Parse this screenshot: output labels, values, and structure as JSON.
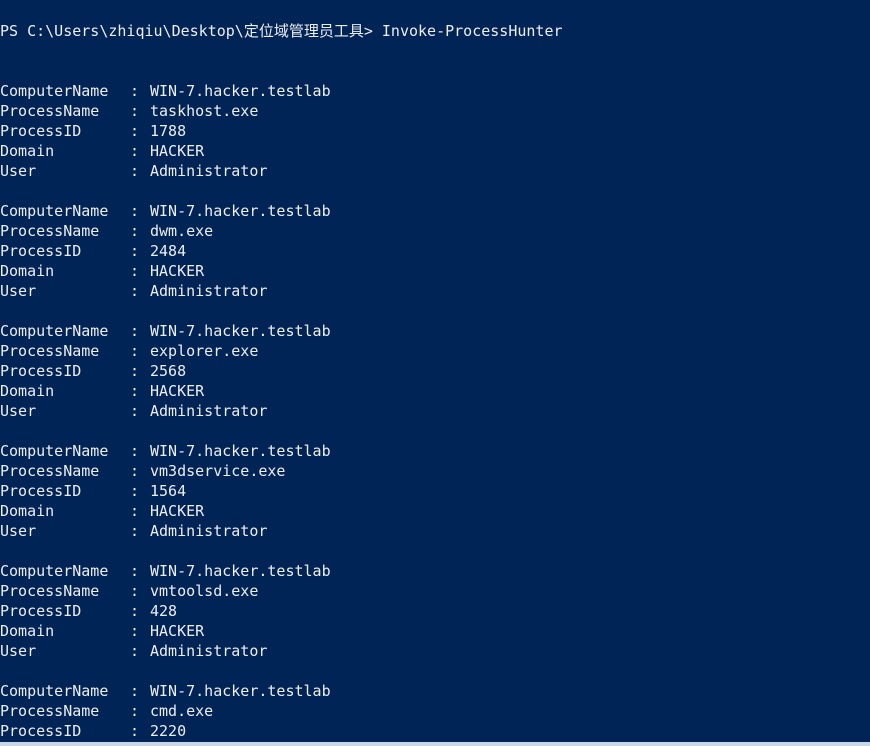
{
  "console": {
    "prompt": "PS C:\\Users\\zhiqiu\\Desktop\\定位域管理员工具>",
    "command": "Invoke-ProcessHunter",
    "separator": ":",
    "field_labels": {
      "computer": "ComputerName",
      "process": "ProcessName",
      "pid": "ProcessID",
      "domain": "Domain",
      "user": "User"
    },
    "records": [
      {
        "computer": "WIN-7.hacker.testlab",
        "process": "taskhost.exe",
        "pid": "1788",
        "domain": "HACKER",
        "user": "Administrator"
      },
      {
        "computer": "WIN-7.hacker.testlab",
        "process": "dwm.exe",
        "pid": "2484",
        "domain": "HACKER",
        "user": "Administrator"
      },
      {
        "computer": "WIN-7.hacker.testlab",
        "process": "explorer.exe",
        "pid": "2568",
        "domain": "HACKER",
        "user": "Administrator"
      },
      {
        "computer": "WIN-7.hacker.testlab",
        "process": "vm3dservice.exe",
        "pid": "1564",
        "domain": "HACKER",
        "user": "Administrator"
      },
      {
        "computer": "WIN-7.hacker.testlab",
        "process": "vmtoolsd.exe",
        "pid": "428",
        "domain": "HACKER",
        "user": "Administrator"
      },
      {
        "computer": "WIN-7.hacker.testlab",
        "process": "cmd.exe",
        "pid": "2220"
      }
    ]
  },
  "colors": {
    "background": "#012456",
    "text": "#eeedf0"
  }
}
